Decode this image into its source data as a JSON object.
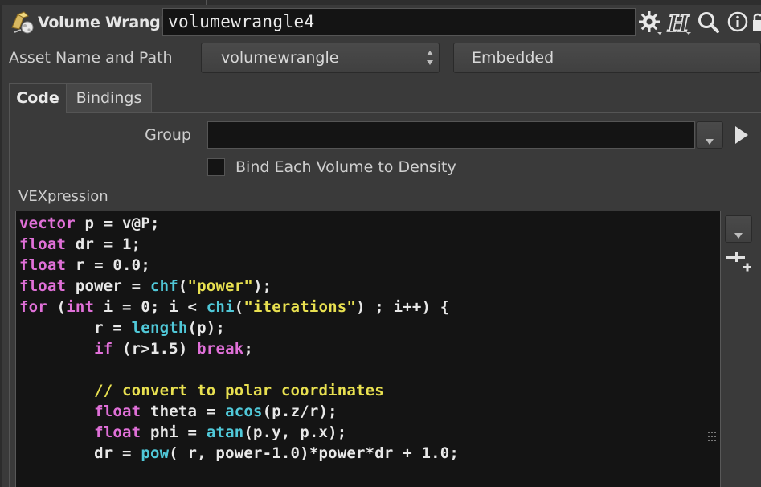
{
  "header": {
    "node_type": "Volume Wrangle",
    "node_name": "volumewrangle4",
    "help_letter": "H"
  },
  "asset": {
    "label": "Asset Name and Path",
    "select_value": "volumewrangle",
    "location": "Embedded"
  },
  "tabs": [
    {
      "label": "Code",
      "active": true
    },
    {
      "label": "Bindings",
      "active": false
    }
  ],
  "group": {
    "label": "Group",
    "value": "",
    "placeholder": ""
  },
  "bind_each_volume": {
    "label": "Bind Each Volume to Density",
    "checked": false
  },
  "vexpression": {
    "label": "VEXpression",
    "lines": [
      [
        {
          "t": "vector",
          "c": "kw"
        },
        {
          "t": " p = v@P;"
        }
      ],
      [
        {
          "t": "float",
          "c": "kw"
        },
        {
          "t": " dr = 1;"
        }
      ],
      [
        {
          "t": "float",
          "c": "kw"
        },
        {
          "t": " r = 0.0;"
        }
      ],
      [
        {
          "t": "float",
          "c": "kw"
        },
        {
          "t": " power = "
        },
        {
          "t": "chf",
          "c": "fn"
        },
        {
          "t": "("
        },
        {
          "t": "\"power\"",
          "c": "str"
        },
        {
          "t": ");"
        }
      ],
      [
        {
          "t": "for",
          "c": "kw"
        },
        {
          "t": " ("
        },
        {
          "t": "int",
          "c": "kw"
        },
        {
          "t": " i = 0; i < "
        },
        {
          "t": "chi",
          "c": "fn"
        },
        {
          "t": "("
        },
        {
          "t": "\"iterations\"",
          "c": "str"
        },
        {
          "t": ") ; i++) {"
        }
      ],
      [
        {
          "t": "        r = "
        },
        {
          "t": "length",
          "c": "fn"
        },
        {
          "t": "(p);"
        }
      ],
      [
        {
          "t": "        "
        },
        {
          "t": "if",
          "c": "kw"
        },
        {
          "t": " (r>1.5) "
        },
        {
          "t": "break",
          "c": "kw"
        },
        {
          "t": ";"
        }
      ],
      [
        {
          "t": ""
        }
      ],
      [
        {
          "t": "        "
        },
        {
          "t": "// convert to polar coordinates",
          "c": "cm"
        }
      ],
      [
        {
          "t": "        "
        },
        {
          "t": "float",
          "c": "kw"
        },
        {
          "t": " theta = "
        },
        {
          "t": "acos",
          "c": "fn"
        },
        {
          "t": "(p.z/r);"
        }
      ],
      [
        {
          "t": "        "
        },
        {
          "t": "float",
          "c": "kw"
        },
        {
          "t": " phi = "
        },
        {
          "t": "atan",
          "c": "fn"
        },
        {
          "t": "(p.y, p.x);"
        }
      ],
      [
        {
          "t": "        dr = "
        },
        {
          "t": "pow",
          "c": "fn"
        },
        {
          "t": "( r, power-1.0)*power*dr + 1.0;"
        }
      ]
    ]
  },
  "colors": {
    "keyword": "#e070d8",
    "function": "#50c8d8",
    "string": "#e8e050",
    "comment": "#e8e050",
    "editor_bg": "#141414",
    "panel_bg": "#3a3a3a"
  },
  "icons": {
    "node": "volume-wrangle-node-icon",
    "gear": "gear-icon",
    "help": "help-h-icon",
    "search": "search-icon",
    "info": "info-icon"
  }
}
